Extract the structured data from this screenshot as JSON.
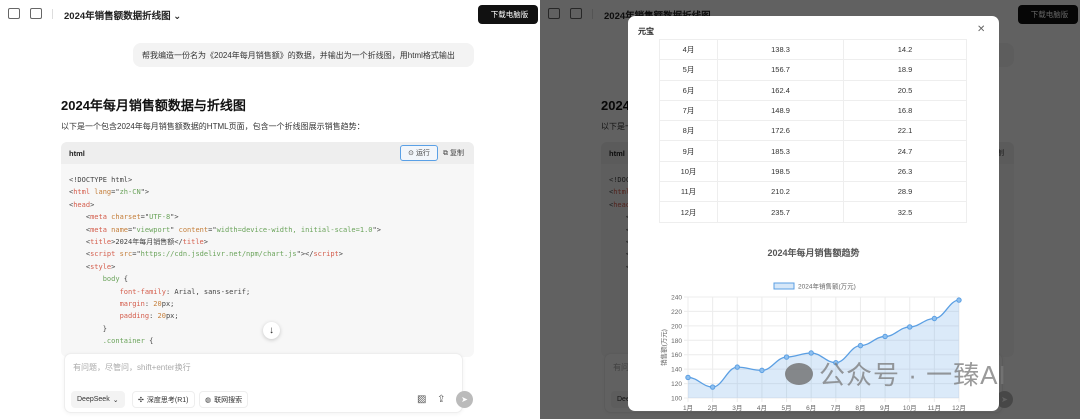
{
  "topbar": {
    "conversation_title": "2024年销售额数据折线图",
    "download_label": "下载电脑版"
  },
  "chat": {
    "user_message": "帮我编造一份名为《2024年每月销售额》的数据，并输出为一个折线图，用html格式输出",
    "heading": "2024年每月销售额数据与折线图",
    "intro": "以下是一个包含2024年每月销售额数据的HTML页面，包含一个折线图展示销售趋势：",
    "code_lang": "html",
    "run_label": "运行",
    "copy_label": "复制",
    "code_lines": [
      [
        [
          "<!DOCTYPE html>",
          "p"
        ]
      ],
      [
        [
          "<",
          "p"
        ],
        [
          "html",
          "t"
        ],
        [
          " lang",
          "a"
        ],
        [
          "=\"",
          "p"
        ],
        [
          "zh-CN",
          "s"
        ],
        [
          "\">",
          "p"
        ]
      ],
      [
        [
          "<",
          "p"
        ],
        [
          "head",
          "t"
        ],
        [
          ">",
          "p"
        ]
      ],
      [
        [
          "    <",
          "p"
        ],
        [
          "meta",
          "t"
        ],
        [
          " charset",
          "a"
        ],
        [
          "=\"",
          "p"
        ],
        [
          "UTF-8",
          "s"
        ],
        [
          "\">",
          "p"
        ]
      ],
      [
        [
          "    <",
          "p"
        ],
        [
          "meta",
          "t"
        ],
        [
          " name",
          "a"
        ],
        [
          "=\"",
          "p"
        ],
        [
          "viewport",
          "s"
        ],
        [
          "\" ",
          "p"
        ],
        [
          "content",
          "a"
        ],
        [
          "=\"",
          "p"
        ],
        [
          "width=device-width, initial-scale=1.0",
          "s"
        ],
        [
          "\">",
          "p"
        ]
      ],
      [
        [
          "    <",
          "p"
        ],
        [
          "title",
          "t"
        ],
        [
          ">2024年每月销售额</",
          "p"
        ],
        [
          "title",
          "t"
        ],
        [
          ">",
          "p"
        ]
      ],
      [
        [
          "    <",
          "p"
        ],
        [
          "script",
          "t"
        ],
        [
          " src",
          "a"
        ],
        [
          "=\"",
          "p"
        ],
        [
          "https://cdn.jsdelivr.net/npm/chart.js",
          "s"
        ],
        [
          "\"></",
          "p"
        ],
        [
          "script",
          "t"
        ],
        [
          ">",
          "p"
        ]
      ],
      [
        [
          "    <",
          "p"
        ],
        [
          "style",
          "t"
        ],
        [
          ">",
          "p"
        ]
      ],
      [
        [
          "        body",
          "k"
        ],
        [
          " {",
          "p"
        ]
      ],
      [
        [
          "            font-family",
          "t"
        ],
        [
          ": Arial, sans-serif;",
          "p"
        ]
      ],
      [
        [
          "            margin",
          "t"
        ],
        [
          ": ",
          "p"
        ],
        [
          "20",
          "a"
        ],
        [
          "px;",
          "p"
        ]
      ],
      [
        [
          "            padding",
          "t"
        ],
        [
          ": ",
          "p"
        ],
        [
          "20",
          "a"
        ],
        [
          "px;",
          "p"
        ]
      ],
      [
        [
          "        }",
          "p"
        ]
      ],
      [
        [
          "        .container",
          "k"
        ],
        [
          " {",
          "p"
        ]
      ]
    ]
  },
  "input": {
    "placeholder": "有问题，尽管问，shift+enter换行",
    "model": "DeepSeek",
    "deep_think": "深度思考(R1)",
    "web_search": "联网搜索"
  },
  "modal": {
    "title": "元宝",
    "table_rows": [
      [
        "4月",
        "138.3",
        "14.2"
      ],
      [
        "5月",
        "156.7",
        "18.9"
      ],
      [
        "6月",
        "162.4",
        "20.5"
      ],
      [
        "7月",
        "148.9",
        "16.8"
      ],
      [
        "8月",
        "172.6",
        "22.1"
      ],
      [
        "9月",
        "185.3",
        "24.7"
      ],
      [
        "10月",
        "198.5",
        "26.3"
      ],
      [
        "11月",
        "210.2",
        "28.9"
      ],
      [
        "12月",
        "235.7",
        "32.5"
      ]
    ]
  },
  "chart_data": {
    "type": "line",
    "title": "2024年每月销售额趋势",
    "legend": [
      "2024年销售额(万元)"
    ],
    "legend_position": "top",
    "ylabel": "销售额(万元)",
    "xlabel": "",
    "categories": [
      "1月",
      "2月",
      "3月",
      "4月",
      "5月",
      "6月",
      "7月",
      "8月",
      "9月",
      "10月",
      "11月",
      "12月"
    ],
    "series": [
      {
        "name": "2024年销售额(万元)",
        "values": [
          128.5,
          115.2,
          142.8,
          138.3,
          156.7,
          162.4,
          148.9,
          172.6,
          185.3,
          198.5,
          210.2,
          235.7
        ],
        "color": "#5b9fe3"
      }
    ],
    "ylim": [
      100,
      240
    ],
    "yticks": [
      100,
      120,
      140,
      160,
      180,
      200,
      220,
      240
    ],
    "grid": true
  },
  "watermark": "公众号 · 一臻AI"
}
